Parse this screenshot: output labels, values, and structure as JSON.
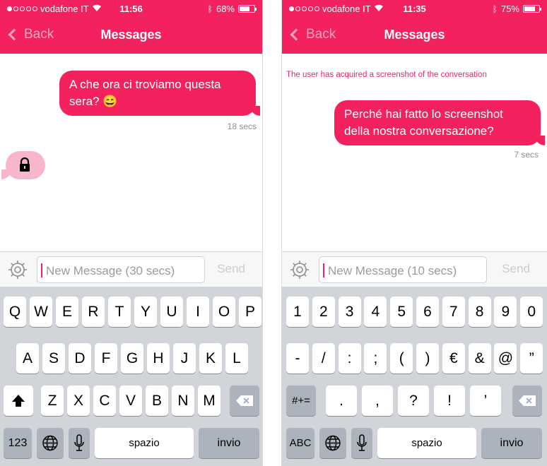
{
  "screens": [
    {
      "status": {
        "carrier": "vodafone IT",
        "time": "11:56",
        "battery": "68%",
        "battery_level": 0.68
      },
      "nav": {
        "back_label": "Back",
        "title": "Messages"
      },
      "messages": [
        {
          "text": "A che ora ci troviamo questa sera? 😄",
          "timestamp": "18 secs"
        }
      ],
      "input": {
        "placeholder": "New Message (30 secs)",
        "send_label": "Send"
      },
      "keyboard": {
        "row1": [
          "Q",
          "W",
          "E",
          "R",
          "T",
          "Y",
          "U",
          "I",
          "O",
          "P"
        ],
        "row2": [
          "A",
          "S",
          "D",
          "F",
          "G",
          "H",
          "J",
          "K",
          "L"
        ],
        "row3": [
          "Z",
          "X",
          "C",
          "V",
          "B",
          "N",
          "M"
        ],
        "mode_key": "123",
        "space": "spazio",
        "return": "invio"
      }
    },
    {
      "status": {
        "carrier": "vodafone IT",
        "time": "11:35",
        "battery": "75%",
        "battery_level": 0.75
      },
      "nav": {
        "back_label": "Back",
        "title": "Messages"
      },
      "system_note": "The user has acquired a screenshot of the conversation",
      "messages": [
        {
          "text": "Perché hai fatto lo screenshot della nostra conversazione?",
          "timestamp": "7 secs"
        }
      ],
      "input": {
        "placeholder": "New Message (10 secs)",
        "send_label": "Send"
      },
      "keyboard": {
        "row1": [
          "1",
          "2",
          "3",
          "4",
          "5",
          "6",
          "7",
          "8",
          "9",
          "0"
        ],
        "row2": [
          "-",
          "/",
          ":",
          ";",
          "(",
          ")",
          "€",
          "&",
          "@",
          "”"
        ],
        "row3": [
          ".",
          ",",
          "?",
          "!",
          "’"
        ],
        "shift_key": "#+=",
        "mode_key": "ABC",
        "space": "spazio",
        "return": "invio"
      }
    }
  ],
  "colors": {
    "accent": "#f3225f",
    "accent_light": "#f7b6ca",
    "keyboard_bg": "#d1d4d9"
  }
}
